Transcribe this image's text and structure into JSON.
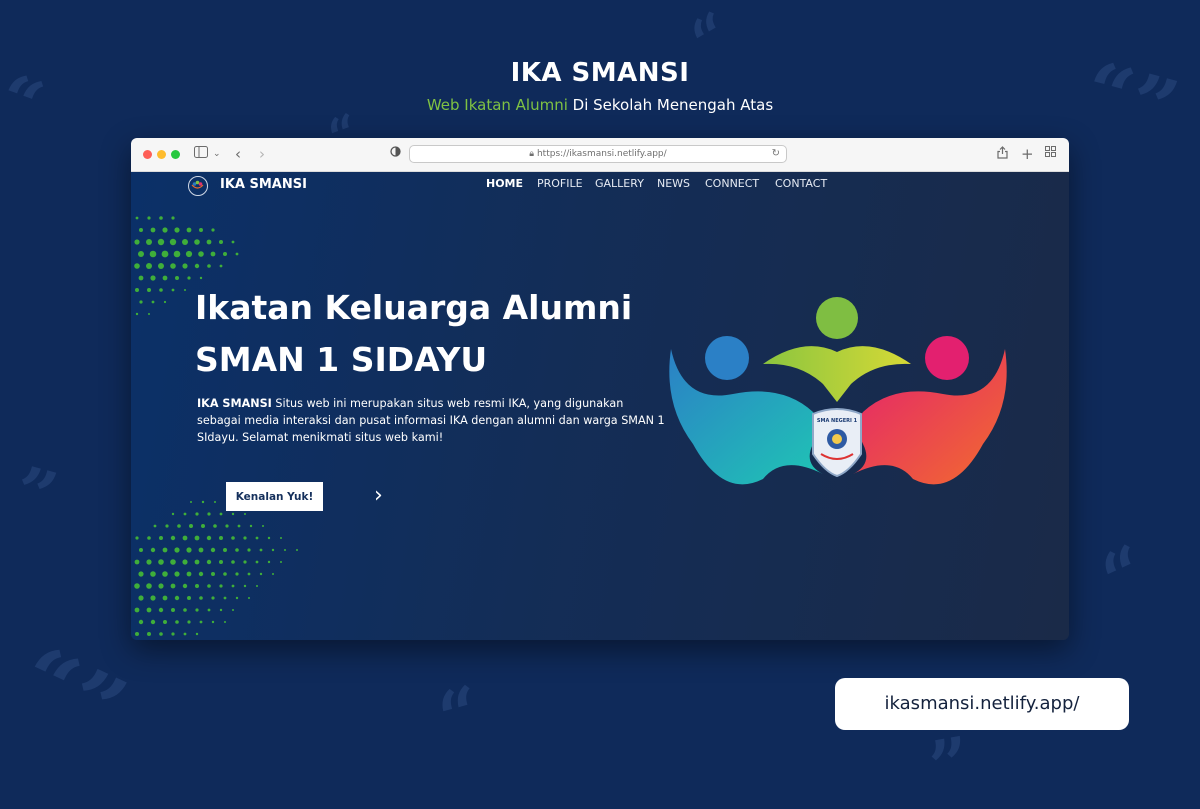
{
  "header": {
    "title": "IKA SMANSI",
    "subtitle_highlight": "Web Ikatan Alumni",
    "subtitle_rest": " Di Sekolah Menengah Atas"
  },
  "browser": {
    "address": "https://ikasmansi.netlify.app/"
  },
  "site": {
    "brand": "IKA SMANSI",
    "nav": [
      {
        "label": "HOME",
        "active": true
      },
      {
        "label": "PROFILE"
      },
      {
        "label": "GALLERY"
      },
      {
        "label": "NEWS"
      },
      {
        "label": "CONNECT"
      },
      {
        "label": "CONTACT"
      }
    ],
    "hero": {
      "title_line1": "Ikatan Keluarga Alumni",
      "title_line2": "SMAN 1 SIDAYU",
      "desc_bold": "IKA SMANSI",
      "desc_rest": " Situs web ini merupakan situs web resmi IKA, yang digunakan sebagai media interaksi dan pusat informasi IKA dengan alumni dan warga SMAN 1 SIdayu. Selamat menikmati situs web kami!",
      "cta_label": "Kenalan Yuk!"
    },
    "emblem_text": "SMA NEGERI 1"
  },
  "footer_url": "ikasmansi.netlify.app/",
  "colors": {
    "background": "#0f2a5a",
    "accent_green": "#7fc243",
    "dot_red": "#fe5f57",
    "dot_yellow": "#febc2e",
    "dot_green": "#28c840"
  }
}
